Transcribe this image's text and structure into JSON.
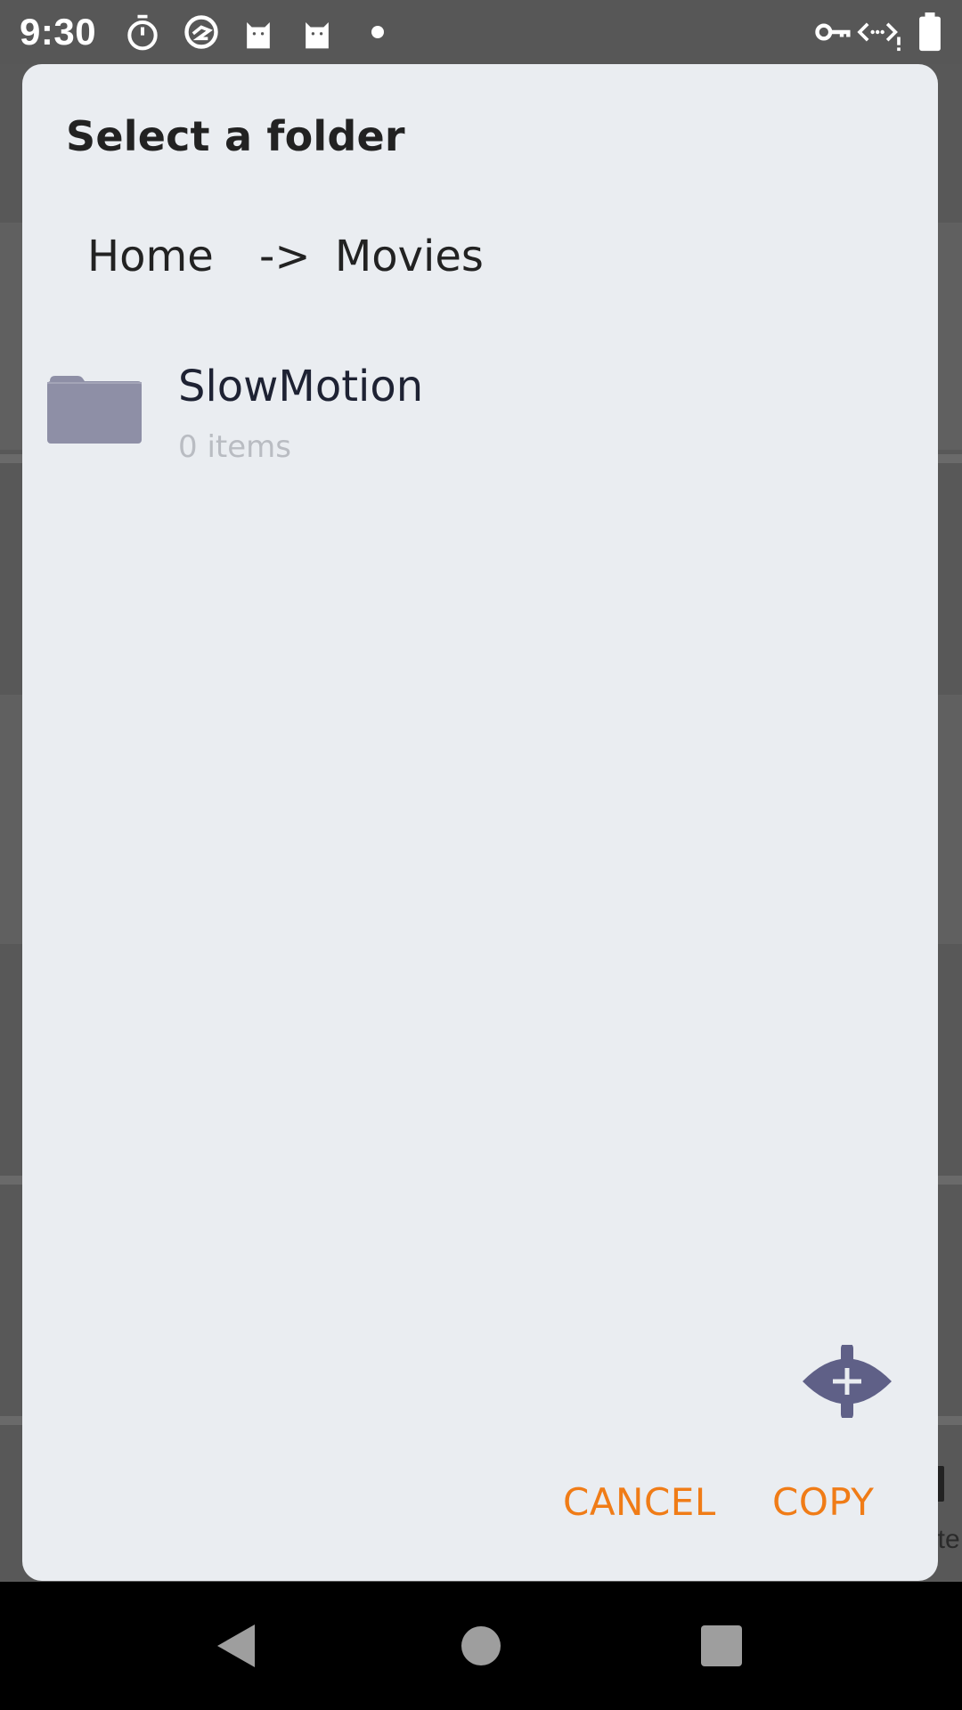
{
  "status_bar": {
    "time": "9:30",
    "icons": [
      "stopwatch-icon",
      "sync-icon",
      "cat-icon",
      "cat-icon",
      "notification-dot",
      "vpn-key-icon",
      "data-saver-icon",
      "battery-icon"
    ]
  },
  "dialog": {
    "title": "Select a folder",
    "breadcrumb": {
      "home": "Home",
      "separator": "->",
      "current": "Movies"
    },
    "folders": [
      {
        "name": "SlowMotion",
        "count": "0 items",
        "icon": "folder-icon"
      }
    ],
    "cancel_label": "CANCEL",
    "copy_label": "COPY"
  },
  "colors": {
    "accent": "#f07c17",
    "dialog_bg": "#eaedf1",
    "folder_icon": "#8e8fa6",
    "fab_icon": "#5f6087"
  },
  "nav_bar": {
    "icons": [
      "back-icon",
      "home-icon",
      "recents-icon"
    ]
  }
}
